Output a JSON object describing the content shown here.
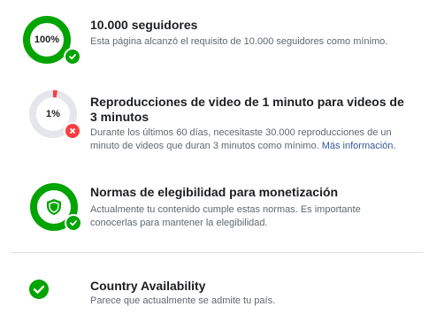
{
  "colors": {
    "success": "#00a400",
    "error": "#fa3e3e",
    "track": "#e4e6eb",
    "link": "#385898"
  },
  "criteria": [
    {
      "progress_label": "100%",
      "progress": 1.0,
      "status": "met",
      "title": "10.000 seguidores",
      "description": "Esta página alcanzó el requisito de 10.000 seguidores como mínimo."
    },
    {
      "progress_label": "1%",
      "progress": 0.01,
      "status": "not-met",
      "title": "Reproducciones de video de 1 minuto para videos de 3 minutos",
      "description": "Durante los últimos 60 días, necesitaste 30.000 reproducciones de un minuto de videos que duran 3 minutos como mínimo.",
      "link": "Más información."
    },
    {
      "icon": "shield-icon",
      "progress": 1.0,
      "status": "met",
      "title": "Normas de elegibilidad para monetización",
      "description": "Actualmente tu contenido cumple estas normas. Es importante conocerlas para mantener la elegibilidad."
    }
  ],
  "country": {
    "icon": "check-circle-icon",
    "status": "met",
    "title": "Country Availability",
    "description": "Parece que actualmente se admite tu país."
  }
}
